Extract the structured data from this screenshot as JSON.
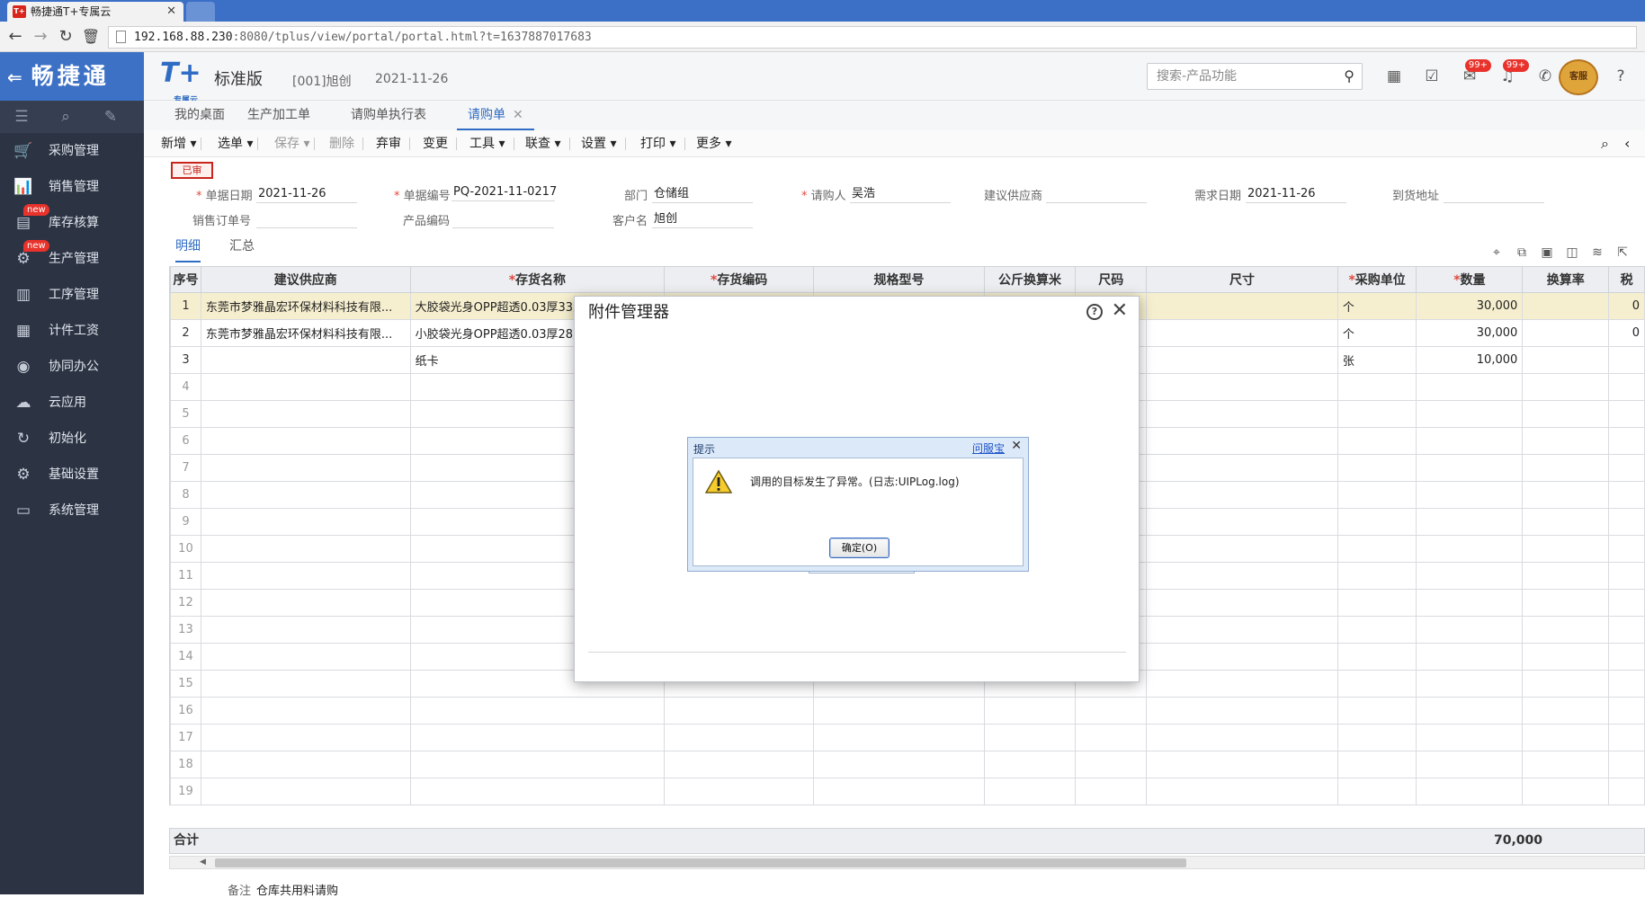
{
  "browser": {
    "tab_title": "畅捷通T+专属云",
    "favicon_text": "T+",
    "url_host": "192.168.88.230",
    "url_rest": ":8080/tplus/view/portal/portal.html?t=1637887017683"
  },
  "sidebar": {
    "brand": "畅捷通",
    "items": [
      {
        "label": "采购管理",
        "icon": "cart-icon",
        "badge": ""
      },
      {
        "label": "销售管理",
        "icon": "bar-chart-icon",
        "badge": ""
      },
      {
        "label": "库存核算",
        "icon": "inventory-icon",
        "badge": "new"
      },
      {
        "label": "生产管理",
        "icon": "production-icon",
        "badge": "new"
      },
      {
        "label": "工序管理",
        "icon": "process-icon",
        "badge": ""
      },
      {
        "label": "计件工资",
        "icon": "wage-icon",
        "badge": ""
      },
      {
        "label": "协同办公",
        "icon": "collab-icon",
        "badge": ""
      },
      {
        "label": "云应用",
        "icon": "cloud-icon",
        "badge": ""
      },
      {
        "label": "初始化",
        "icon": "refresh-icon",
        "badge": ""
      },
      {
        "label": "基础设置",
        "icon": "settings-icon",
        "badge": ""
      },
      {
        "label": "系统管理",
        "icon": "system-icon",
        "badge": ""
      }
    ]
  },
  "header": {
    "logo": "T+",
    "logo_sub": "专属云",
    "edition": "标准版",
    "account": "[001]旭创",
    "date": "2021-11-26",
    "search_placeholder": "搜索-产品功能",
    "badge1": "99+",
    "badge2": "99+",
    "service_label": "客服"
  },
  "page_tabs": [
    "我的桌面",
    "生产加工单",
    "请购单执行表",
    "请购单"
  ],
  "toolbar": [
    "新增",
    "选单",
    "保存",
    "删除",
    "弃审",
    "变更",
    "工具",
    "联查",
    "设置",
    "打印",
    "更多"
  ],
  "form": {
    "stamp": "已审",
    "doc_date_label": "单据日期",
    "doc_date": "2021-11-26",
    "doc_no_label": "单据编号",
    "doc_no": "PQ-2021-11-0217",
    "dept_label": "部门",
    "dept": "仓储组",
    "requester_label": "请购人",
    "requester": "吴浩",
    "supplier_label": "建议供应商",
    "supplier": "",
    "need_date_label": "需求日期",
    "need_date": "2021-11-26",
    "address_label": "到货地址",
    "address": "",
    "so_label": "销售订单号",
    "so": "",
    "product_code_label": "产品编码",
    "product_code": "",
    "customer_label": "客户名",
    "customer": "旭创"
  },
  "subtabs": {
    "detail": "明细",
    "summary": "汇总"
  },
  "grid": {
    "columns": [
      {
        "label": "序号",
        "required": false
      },
      {
        "label": "建议供应商",
        "required": false
      },
      {
        "label": "存货名称",
        "required": true
      },
      {
        "label": "存货编码",
        "required": true
      },
      {
        "label": "规格型号",
        "required": false
      },
      {
        "label": "公斤换算米",
        "required": false
      },
      {
        "label": "尺码",
        "required": false
      },
      {
        "label": "尺寸",
        "required": false
      },
      {
        "label": "采购单位",
        "required": true
      },
      {
        "label": "数量",
        "required": true
      },
      {
        "label": "换算率",
        "required": false
      },
      {
        "label": "税",
        "required": false
      }
    ],
    "rows": [
      [
        "1",
        "东莞市梦雅晶宏环保材料科技有限...",
        "大胶袋光身OPP超透0.03厚33宽",
        "",
        "",
        "",
        "",
        "",
        "个",
        "30,000",
        "",
        "0"
      ],
      [
        "2",
        "东莞市梦雅晶宏环保材料科技有限...",
        "小胶袋光身OPP超透0.03厚28宽",
        "",
        "",
        "",
        "",
        "",
        "个",
        "30,000",
        "",
        "0"
      ],
      [
        "3",
        "",
        "纸卡",
        "",
        "",
        "",
        "",
        "",
        "张",
        "10,000",
        "",
        ""
      ],
      [
        "4",
        "",
        "",
        "",
        "",
        "",
        "",
        "",
        "",
        "",
        "",
        ""
      ],
      [
        "5",
        "",
        "",
        "",
        "",
        "",
        "",
        "",
        "",
        "",
        "",
        ""
      ],
      [
        "6",
        "",
        "",
        "",
        "",
        "",
        "",
        "",
        "",
        "",
        "",
        ""
      ],
      [
        "7",
        "",
        "",
        "",
        "",
        "",
        "",
        "",
        "",
        "",
        "",
        ""
      ],
      [
        "8",
        "",
        "",
        "",
        "",
        "",
        "",
        "",
        "",
        "",
        "",
        ""
      ],
      [
        "9",
        "",
        "",
        "",
        "",
        "",
        "",
        "",
        "",
        "",
        "",
        ""
      ],
      [
        "10",
        "",
        "",
        "",
        "",
        "",
        "",
        "",
        "",
        "",
        "",
        ""
      ],
      [
        "11",
        "",
        "",
        "",
        "",
        "",
        "",
        "",
        "",
        "",
        "",
        ""
      ],
      [
        "12",
        "",
        "",
        "",
        "",
        "",
        "",
        "",
        "",
        "",
        "",
        ""
      ],
      [
        "13",
        "",
        "",
        "",
        "",
        "",
        "",
        "",
        "",
        "",
        "",
        ""
      ],
      [
        "14",
        "",
        "",
        "",
        "",
        "",
        "",
        "",
        "",
        "",
        "",
        ""
      ],
      [
        "15",
        "",
        "",
        "",
        "",
        "",
        "",
        "",
        "",
        "",
        "",
        ""
      ],
      [
        "16",
        "",
        "",
        "",
        "",
        "",
        "",
        "",
        "",
        "",
        "",
        ""
      ],
      [
        "17",
        "",
        "",
        "",
        "",
        "",
        "",
        "",
        "",
        "",
        "",
        ""
      ],
      [
        "18",
        "",
        "",
        "",
        "",
        "",
        "",
        "",
        "",
        "",
        "",
        ""
      ],
      [
        "19",
        "",
        "",
        "",
        "",
        "",
        "",
        "",
        "",
        "",
        "",
        ""
      ]
    ],
    "total_label": "合计",
    "total_qty": "70,000"
  },
  "remark_label": "备注",
  "remark": "仓库共用料请购",
  "attachment_dialog": {
    "title": "附件管理器"
  },
  "alert": {
    "title": "提示",
    "help_link": "问服宝",
    "message": "调用的目标发生了异常。(日志:UIPLog.log)",
    "ok": "确定(O)"
  },
  "colors": {
    "accent": "#2f6cc4",
    "sidebar": "#2c3444",
    "brand": "#3d71c5",
    "badge": "#e8322b",
    "selected_row": "#f6efcf"
  }
}
